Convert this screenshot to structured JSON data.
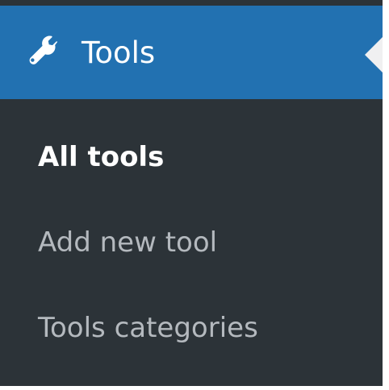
{
  "menu": {
    "header": {
      "label": "Tools",
      "icon": "wrench-icon"
    },
    "items": [
      {
        "label": "All tools",
        "current": true
      },
      {
        "label": "Add new tool",
        "current": false
      },
      {
        "label": "Tools categories",
        "current": false
      }
    ]
  },
  "colors": {
    "sidebar_bg": "#2c3338",
    "active_header_bg": "#2271b1",
    "active_text": "#ffffff",
    "inactive_text": "#b4b9be",
    "page_bg": "#f0f0f1"
  }
}
